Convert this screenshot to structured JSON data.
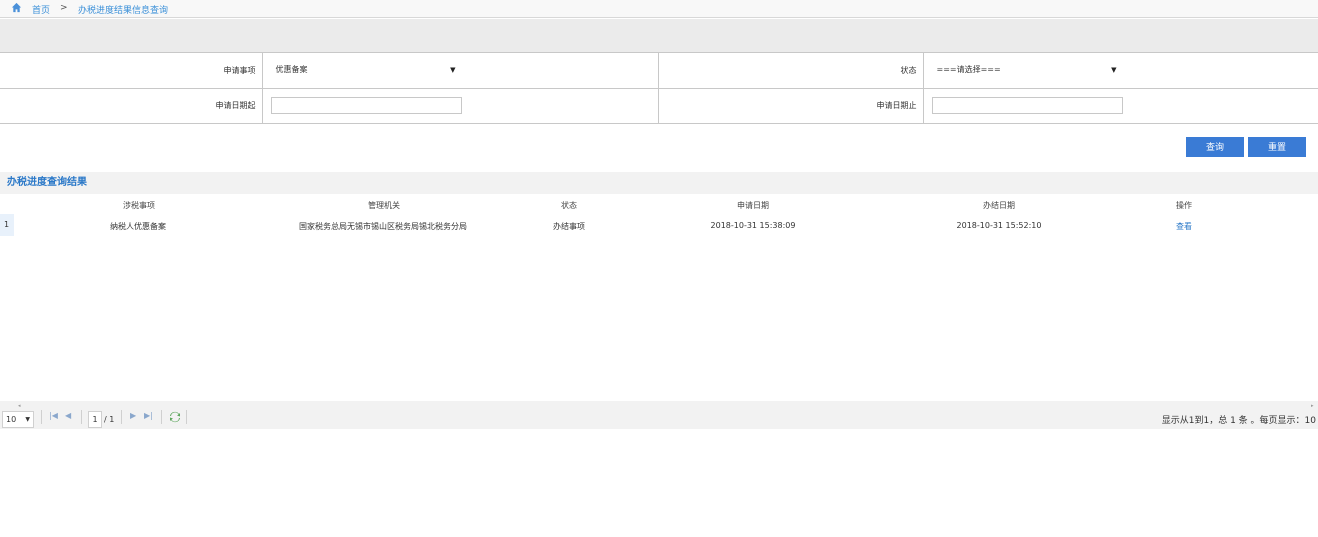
{
  "breadcrumb": {
    "home": "首页",
    "separator": ">",
    "current": "办税进度结果信息查询"
  },
  "form": {
    "item_label": "申请事项",
    "item_value": "优惠备案",
    "status_label": "状态",
    "status_value": "===请选择===",
    "date_start_label": "申请日期起",
    "date_start_value": "",
    "date_end_label": "申请日期止",
    "date_end_value": ""
  },
  "buttons": {
    "query": "查询",
    "reset": "重置"
  },
  "result": {
    "title": "办税进度查询结果",
    "columns": [
      "涉税事项",
      "管理机关",
      "状态",
      "申请日期",
      "办结日期",
      "操作"
    ],
    "rows": [
      {
        "index": "1",
        "item": "纳税人优惠备案",
        "office": "国家税务总局无锡市锡山区税务局锡北税务分局",
        "status": "办结事项",
        "apply_date": "2018-10-31 15:38:09",
        "finish_date": "2018-10-31 15:52:10",
        "action": "查看"
      }
    ]
  },
  "pager": {
    "page_size": "10",
    "current_page": "1",
    "total_pages": "/ 1",
    "summary": "显示从1到1，总 1 条 。每页显示：10"
  },
  "colors": {
    "accent": "#3a7bd5",
    "link": "#2a78c8"
  }
}
